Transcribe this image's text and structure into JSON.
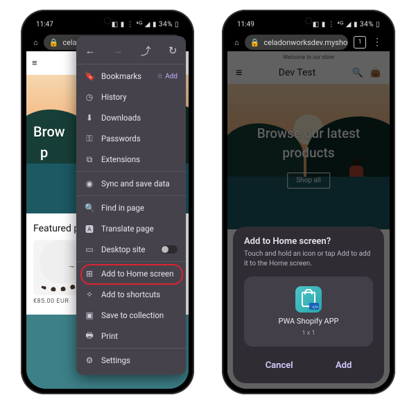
{
  "left": {
    "status": {
      "time": "11:47",
      "right": "◧ ▮ ⋮ ⁴ᴳ ◢ ▮ 34% ▯"
    },
    "addressbar": {
      "url_short": "celad"
    },
    "store": {
      "hero_line1": "Brow",
      "hero_line2": "p",
      "featured": "Featured pro",
      "price": "€85.00 EUR"
    },
    "menu": {
      "bookmarks": "Bookmarks",
      "add": "Add",
      "history": "History",
      "downloads": "Downloads",
      "passwords": "Passwords",
      "extensions": "Extensions",
      "sync": "Sync and save data",
      "find": "Find in page",
      "translate": "Translate page",
      "desktop": "Desktop site",
      "addhome": "Add to Home screen",
      "shortcuts": "Add to shortcuts",
      "collection": "Save to collection",
      "print": "Print",
      "settings": "Settings"
    }
  },
  "right": {
    "status": {
      "time": "11:49",
      "right": "◧ ▮ ⋮ ⁴ᴳ ◢ ▮ 34% ▯"
    },
    "addressbar": {
      "url": "celadonworksdev.myshopify.c",
      "tabs": "1"
    },
    "store": {
      "welcome": "Welcome to our store",
      "brand": "Dev Test",
      "hero_line1": "Browse our latest",
      "hero_line2": "products",
      "cta": "Shop all"
    },
    "sheet": {
      "title": "Add to Home screen?",
      "sub": "Touch and hold an icon or tap Add to add it to the Home screen.",
      "app_name": "PWA Shopify APP",
      "app_size": "1 x 1",
      "cancel": "Cancel",
      "add": "Add"
    }
  }
}
